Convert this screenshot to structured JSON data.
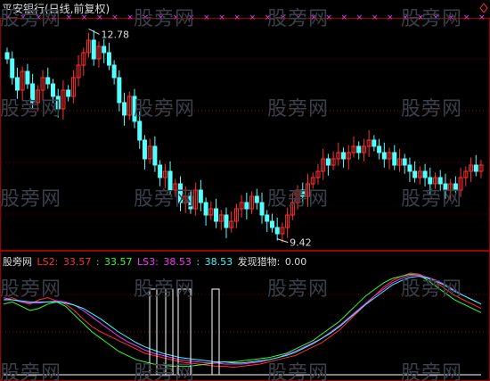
{
  "header": {
    "title": "平安银行(日线,前复权)",
    "corner_icon": "diamond-outline-icon"
  },
  "watermark": {
    "text": "股旁网"
  },
  "indicator": {
    "name": "股旁网",
    "ls2_label": "LS2:",
    "ls2_value": "33.57",
    "ls1_label": ":",
    "ls1_value": "33.57",
    "ls3_label": "LS3:",
    "ls3_value": "38.53",
    "ls4_label": ":",
    "ls4_value": "38.53",
    "fx_label": "发现猎物:",
    "fx_value": "0.00"
  },
  "colors": {
    "background": "#000000",
    "up_candle": "#ff3030",
    "down_candle": "#54ffff",
    "frame": "#a00000",
    "grid": "#8a0000",
    "signal_marker": "#ff30ff",
    "ls2": "#ff3030",
    "ls1": "#30ff30",
    "ls3": "#ff30ff",
    "ls4": "#30ffff",
    "hunt": "#ffffff"
  },
  "chart_data": [
    {
      "type": "candlestick",
      "title": "平安银行(日线,前复权)",
      "price_high_label": "12.78",
      "price_low_label": "9.42",
      "high": 12.78,
      "low": 9.42,
      "closes": [
        12.3,
        12.0,
        11.8,
        12.1,
        11.9,
        11.6,
        11.8,
        12.0,
        11.9,
        11.7,
        11.5,
        11.8,
        11.7,
        12.0,
        12.2,
        12.4,
        12.6,
        12.3,
        12.5,
        12.4,
        12.2,
        12.0,
        11.6,
        11.4,
        11.7,
        11.3,
        11.0,
        10.7,
        10.9,
        10.6,
        10.4,
        10.5,
        10.2,
        10.3,
        10.0,
        10.1,
        9.9,
        10.2,
        10.0,
        9.8,
        9.9,
        9.7,
        9.8,
        9.6,
        9.7,
        9.9,
        10.0,
        9.9,
        10.1,
        10.0,
        9.8,
        9.7,
        9.6,
        9.5,
        9.6,
        9.8,
        10.0,
        10.2,
        10.1,
        10.3,
        10.4,
        10.5,
        10.7,
        10.6,
        10.7,
        10.8,
        10.7,
        10.8,
        10.9,
        10.8,
        10.9,
        11.0,
        10.9,
        10.8,
        10.7,
        10.8,
        10.6,
        10.7,
        10.6,
        10.5,
        10.4,
        10.5,
        10.4,
        10.3,
        10.4,
        10.3,
        10.2,
        10.3,
        10.2,
        10.4,
        10.5,
        10.6,
        10.5,
        10.6
      ],
      "signal_markers_row": "×"
    },
    {
      "type": "line",
      "series": [
        {
          "name": "LS2",
          "values": [
            70,
            72,
            68,
            66,
            70,
            72,
            69,
            66,
            60,
            52,
            45,
            40,
            36,
            32,
            28,
            24,
            20,
            18,
            16,
            14,
            12,
            11,
            10,
            9,
            8,
            8,
            7,
            8,
            9,
            10,
            12,
            14,
            16,
            18,
            22,
            26,
            30,
            36,
            42,
            50,
            58,
            66,
            74,
            82,
            88,
            92,
            95,
            94,
            90,
            86,
            80,
            74,
            70,
            66,
            62
          ]
        },
        {
          "name": "LS1",
          "values": [
            66,
            68,
            64,
            60,
            62,
            66,
            68,
            64,
            56,
            48,
            40,
            34,
            28,
            22,
            18,
            14,
            12,
            10,
            9,
            8,
            8,
            8,
            9,
            10,
            11,
            12,
            12,
            13,
            14,
            15,
            16,
            18,
            20,
            24,
            28,
            32,
            38,
            44,
            50,
            58,
            66,
            74,
            80,
            86,
            90,
            92,
            94,
            93,
            88,
            82,
            76,
            70,
            66,
            62,
            58
          ]
        },
        {
          "name": "LS3",
          "values": [
            72,
            70,
            68,
            67,
            67,
            68,
            69,
            68,
            65,
            60,
            54,
            48,
            42,
            36,
            31,
            27,
            23,
            20,
            18,
            16,
            14,
            13,
            12,
            11,
            11,
            10,
            10,
            10,
            11,
            12,
            14,
            16,
            19,
            22,
            26,
            30,
            34,
            40,
            46,
            53,
            60,
            67,
            74,
            80,
            86,
            90,
            93,
            93,
            91,
            88,
            84,
            79,
            74,
            70,
            66
          ]
        },
        {
          "name": "LS4",
          "values": [
            70,
            70,
            69,
            68,
            68,
            68,
            68,
            67,
            65,
            62,
            57,
            52,
            46,
            40,
            35,
            30,
            26,
            23,
            20,
            18,
            16,
            15,
            14,
            13,
            12,
            12,
            11,
            11,
            12,
            13,
            14,
            16,
            18,
            21,
            25,
            29,
            34,
            39,
            45,
            52,
            59,
            66,
            72,
            78,
            84,
            88,
            91,
            92,
            90,
            87,
            83,
            78,
            74,
            70,
            66
          ]
        },
        {
          "name": "发现猎物",
          "values": [
            0,
            0,
            0,
            0,
            0,
            0,
            0,
            0,
            0,
            0,
            0,
            0,
            0,
            0,
            0,
            0,
            0,
            0,
            0,
            0,
            0,
            0,
            0,
            0,
            0,
            0,
            0,
            0,
            0,
            0,
            0,
            0,
            0,
            0,
            0,
            0,
            0,
            0,
            0,
            0,
            0,
            0,
            0,
            0,
            0,
            0,
            0,
            0,
            0,
            0,
            0,
            0,
            0,
            0,
            0
          ]
        }
      ],
      "hunt_spikes_visible": true
    }
  ]
}
